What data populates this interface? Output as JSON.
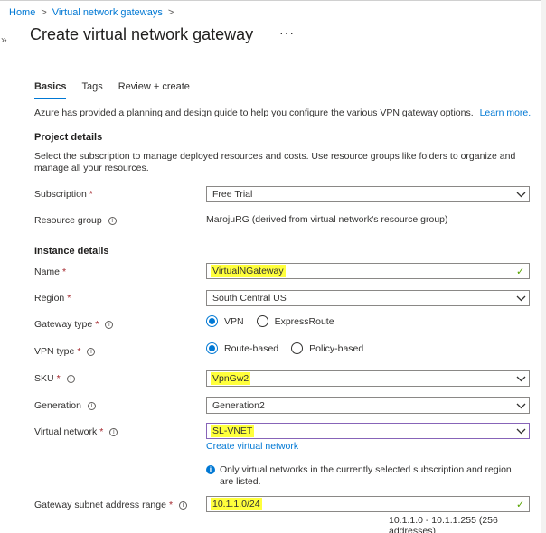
{
  "breadcrumb": {
    "home": "Home",
    "parent": "Virtual network gateways",
    "sep": ">"
  },
  "header": {
    "title": "Create virtual network gateway",
    "more": "···",
    "expander": "»"
  },
  "tabs": [
    {
      "label": "Basics",
      "active": true
    },
    {
      "label": "Tags",
      "active": false
    },
    {
      "label": "Review + create",
      "active": false
    }
  ],
  "intro": {
    "text": "Azure has provided a planning and design guide to help you configure the various VPN gateway options.",
    "link": "Learn more."
  },
  "project": {
    "heading": "Project details",
    "desc": "Select the subscription to manage deployed resources and costs. Use resource groups like folders to organize and manage all your resources.",
    "subscription_label": "Subscription",
    "subscription_value": "Free Trial",
    "rg_label": "Resource group",
    "rg_value": "MarojuRG (derived from virtual network's resource group)"
  },
  "instance": {
    "heading": "Instance details",
    "name_label": "Name",
    "name_value": "VirtualNGateway",
    "region_label": "Region",
    "region_value": "South Central US",
    "gwtype_label": "Gateway type",
    "gwtype_opt1": "VPN",
    "gwtype_opt2": "ExpressRoute",
    "vpntype_label": "VPN type",
    "vpntype_opt1": "Route-based",
    "vpntype_opt2": "Policy-based",
    "sku_label": "SKU",
    "sku_value": "VpnGw2",
    "gen_label": "Generation",
    "gen_value": "Generation2",
    "vnet_label": "Virtual network",
    "vnet_value": "SL-VNET",
    "vnet_create_link": "Create virtual network",
    "vnet_note": "Only virtual networks in the currently selected subscription and region are listed.",
    "subnet_label": "Gateway subnet address range",
    "subnet_value": "10.1.1.0/24",
    "subnet_range": "10.1.1.0 - 10.1.1.255 (256 addresses)"
  },
  "common": {
    "required_mark": "*",
    "info_glyph": "i",
    "check_glyph": "✓"
  },
  "colors": {
    "accent": "#0078d4",
    "required": "#a4262c",
    "highlight": "#ffff3c",
    "valid": "#57a300"
  }
}
